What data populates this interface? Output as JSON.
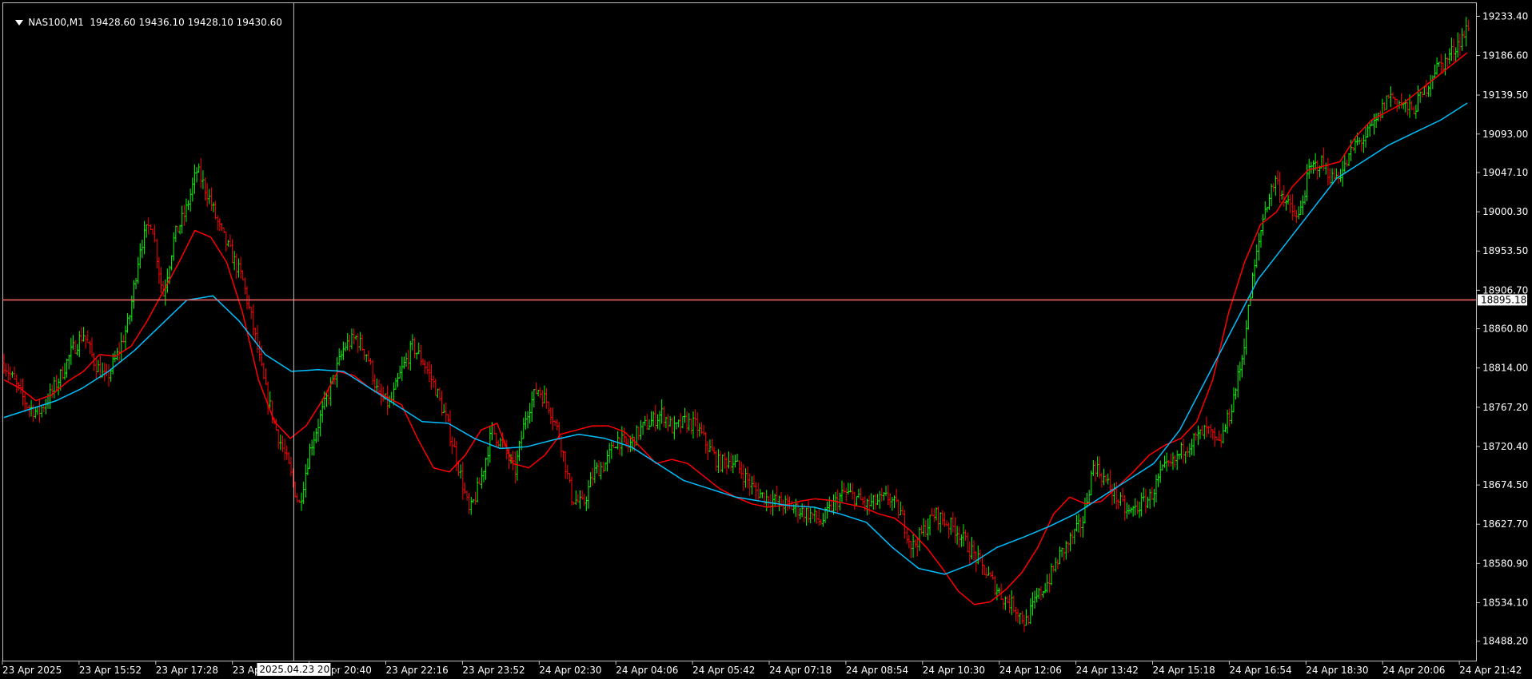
{
  "header": {
    "symbol": "NAS100,M1",
    "ohlc": "19428.60 19436.10 19428.10 19430.60"
  },
  "colors": {
    "background": "#000000",
    "frame": "#c0c0c0",
    "text": "#ffffff",
    "bar_up": "#00ff00",
    "bar_down": "#ff0000",
    "ma_fast": "#ff0000",
    "ma_slow": "#00bfff",
    "crosshair": "#c0c0c0",
    "hline": "#ff6b6b"
  },
  "icons": {
    "header_toggle": "triangle-down-icon"
  },
  "chart_data": {
    "type": "line",
    "ylim": [
      18465,
      19250
    ],
    "y_ticks": [
      "19233.40",
      "19186.60",
      "19139.50",
      "19093.00",
      "19047.10",
      "19000.30",
      "18953.50",
      "18906.70",
      "18860.80",
      "18814.00",
      "18767.20",
      "18720.40",
      "18674.50",
      "18627.70",
      "18580.90",
      "18534.10",
      "18488.20"
    ],
    "x_ticks": [
      "23 Apr 2025",
      "23 Apr 15:52",
      "23 Apr 17:28",
      "23 Apr 19:04",
      "23 Apr 20:40",
      "23 Apr 22:16",
      "23 Apr 23:52",
      "24 Apr 02:30",
      "24 Apr 04:06",
      "24 Apr 05:42",
      "24 Apr 07:18",
      "24 Apr 08:54",
      "24 Apr 10:30",
      "24 Apr 12:06",
      "24 Apr 13:42",
      "24 Apr 15:18",
      "24 Apr 16:54",
      "24 Apr 18:30",
      "24 Apr 20:06",
      "24 Apr 21:42"
    ],
    "horizontal_line": {
      "price": 18895.18,
      "label": "18895.18"
    },
    "crosshair": {
      "x_label": "2025.04.23 20:30",
      "x_index": 3.8
    },
    "series": [
      {
        "style": "bars",
        "values": [
          18820,
          18795,
          18770,
          18760,
          18780,
          18805,
          18835,
          18855,
          18820,
          18800,
          18830,
          18870,
          18960,
          18990,
          18900,
          18970,
          19000,
          19050,
          19020,
          18980,
          18950,
          18920,
          18860,
          18790,
          18740,
          18700,
          18650,
          18720,
          18760,
          18800,
          18840,
          18850,
          18830,
          18780,
          18770,
          18810,
          18840,
          18820,
          18790,
          18750,
          18700,
          18640,
          18680,
          18740,
          18720,
          18690,
          18760,
          18790,
          18770,
          18730,
          18660,
          18650,
          18690,
          18700,
          18730,
          18720,
          18740,
          18750,
          18760,
          18740,
          18750,
          18745,
          18720,
          18700,
          18705,
          18690,
          18670,
          18660,
          18655,
          18650,
          18645,
          18640,
          18630,
          18650,
          18665,
          18660,
          18650,
          18655,
          18660,
          18640,
          18600,
          18620,
          18640,
          18630,
          18620,
          18600,
          18580,
          18560,
          18540,
          18530,
          18510,
          18540,
          18560,
          18590,
          18610,
          18630,
          18700,
          18680,
          18660,
          18640,
          18650,
          18660,
          18690,
          18700,
          18720,
          18730,
          18740,
          18720,
          18760,
          18820,
          18920,
          19000,
          19040,
          19010,
          18990,
          19050,
          19060,
          19040,
          19050,
          19080,
          19090,
          19110,
          19140,
          19130,
          19120,
          19140,
          19170,
          19180,
          19200,
          19220
        ]
      },
      {
        "name": "",
        "style": "line",
        "values": [
          18800,
          18790,
          18775,
          18782,
          18798,
          18810,
          18830,
          18828,
          18840,
          18870,
          18905,
          18940,
          18978,
          18970,
          18940,
          18880,
          18800,
          18750,
          18730,
          18745,
          18775,
          18810,
          18805,
          18790,
          18780,
          18770,
          18730,
          18695,
          18690,
          18710,
          18740,
          18748,
          18700,
          18695,
          18710,
          18735,
          18740,
          18745,
          18745,
          18738,
          18720,
          18700,
          18705,
          18700,
          18685,
          18670,
          18660,
          18652,
          18648,
          18650,
          18655,
          18658,
          18656,
          18652,
          18648,
          18640,
          18635,
          18620,
          18600,
          18575,
          18548,
          18532,
          18535,
          18550,
          18570,
          18600,
          18640,
          18660,
          18652,
          18655,
          18672,
          18690,
          18710,
          18722,
          18730,
          18750,
          18800,
          18880,
          18940,
          18985,
          19000,
          19030,
          19050,
          19055,
          19060,
          19090,
          19110,
          19120,
          19130,
          19145,
          19160,
          19175,
          19190
        ]
      },
      {
        "name": "",
        "style": "line",
        "values": [
          18755,
          18765,
          18775,
          18790,
          18810,
          18835,
          18865,
          18895,
          18900,
          18870,
          18830,
          18810,
          18812,
          18810,
          18790,
          18770,
          18750,
          18748,
          18730,
          18718,
          18720,
          18728,
          18735,
          18730,
          18720,
          18700,
          18680,
          18670,
          18660,
          18655,
          18650,
          18648,
          18640,
          18630,
          18600,
          18575,
          18568,
          18580,
          18600,
          18612,
          18625,
          18640,
          18660,
          18680,
          18700,
          18740,
          18800,
          18860,
          18920,
          18960,
          19000,
          19040,
          19060,
          19080,
          19095,
          19110,
          19130
        ]
      }
    ]
  }
}
